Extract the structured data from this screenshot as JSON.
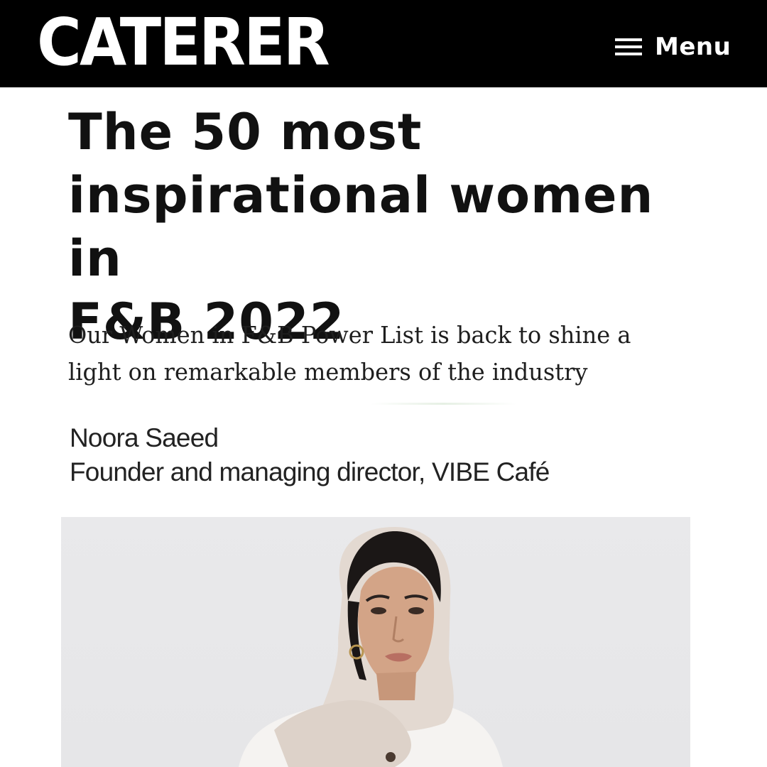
{
  "header": {
    "logo_text": "CATERER",
    "menu_label": "Menu",
    "menu_icon": "hamburger-menu-icon",
    "background": "#000000"
  },
  "article": {
    "headline_lines": [
      "The 50 most",
      "inspirational women in",
      "F&B 2022"
    ],
    "standfirst_lines": [
      "Our Women in F&B Power List is back to shine a",
      "light on remarkable members of the industry"
    ]
  },
  "profile": {
    "name": "Noora Saeed",
    "role": "Founder and managing director, VIBE Café"
  }
}
